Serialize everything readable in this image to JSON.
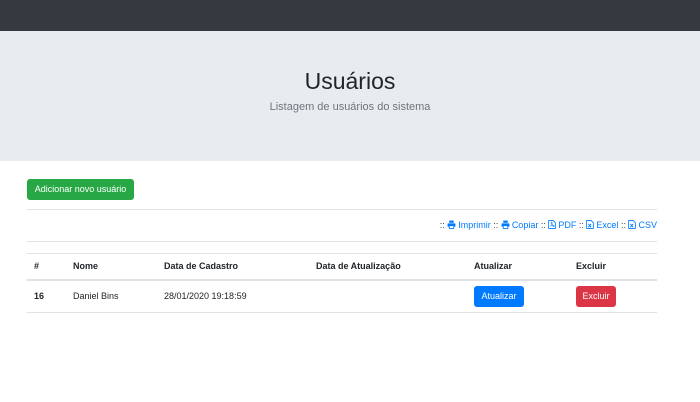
{
  "header": {
    "title": "Usuários",
    "subtitle": "Listagem de usuários do sistema"
  },
  "actions": {
    "add_label": "Adicionar novo usuário"
  },
  "export": {
    "separator": "::",
    "items": [
      {
        "label": "Imprimir",
        "icon": "print-icon"
      },
      {
        "label": "Copiar",
        "icon": "print-icon"
      },
      {
        "label": "PDF",
        "icon": "file-pdf-icon"
      },
      {
        "label": "Excel",
        "icon": "file-excel-icon"
      },
      {
        "label": "CSV",
        "icon": "file-csv-icon"
      }
    ],
    "link_color": "#007bff"
  },
  "table": {
    "headers": [
      "#",
      "Nome",
      "Data de Cadastro",
      "Data de Atualização",
      "Atualizar",
      "Excluir"
    ],
    "rows": [
      {
        "id": "16",
        "nome": "Daniel Bins",
        "cadastro": "28/01/2020 19:18:59",
        "atualizacao": "",
        "atualizar_label": "Atualizar",
        "excluir_label": "Excluir"
      }
    ]
  },
  "colors": {
    "navbar": "#343a40",
    "jumbotron": "#e9ecef",
    "success": "#28a745",
    "primary": "#007bff",
    "danger": "#dc3545"
  }
}
